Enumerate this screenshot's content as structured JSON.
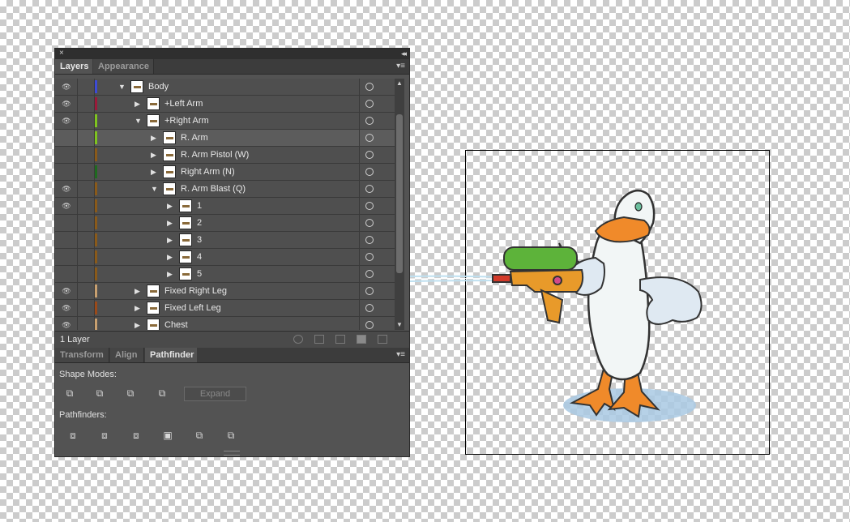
{
  "panel": {
    "close_glyph": "×",
    "collapse_glyph": "◂◂",
    "tabs": [
      {
        "label": "Layers",
        "active": true
      },
      {
        "label": "Appearance",
        "active": false
      }
    ],
    "menu_glyph": "▾≡"
  },
  "layers": {
    "rows": [
      {
        "name": "Body",
        "visible": true,
        "color": "#3d4bd6",
        "expanded": true,
        "depth": 0
      },
      {
        "name": "+Left Arm",
        "visible": true,
        "color": "#9b1a3a",
        "expanded": false,
        "depth": 1
      },
      {
        "name": "+Right Arm",
        "visible": true,
        "color": "#7fc41f",
        "expanded": true,
        "depth": 1
      },
      {
        "name": "R. Arm",
        "visible": false,
        "color": "#7fc41f",
        "expanded": false,
        "depth": 2,
        "selected": true
      },
      {
        "name": "R. Arm Pistol (W)",
        "visible": false,
        "color": "#8a5a1a",
        "expanded": false,
        "depth": 2
      },
      {
        "name": "Right Arm (N)",
        "visible": false,
        "color": "#1f6b1f",
        "expanded": false,
        "depth": 2
      },
      {
        "name": "R. Arm Blast (Q)",
        "visible": true,
        "color": "#8a5a1a",
        "expanded": true,
        "depth": 2
      },
      {
        "name": "1",
        "visible": true,
        "color": "#8a5a1a",
        "expanded": false,
        "depth": 3
      },
      {
        "name": "2",
        "visible": false,
        "color": "#8a5a1a",
        "expanded": false,
        "depth": 3
      },
      {
        "name": "3",
        "visible": false,
        "color": "#8a5a1a",
        "expanded": false,
        "depth": 3
      },
      {
        "name": "4",
        "visible": false,
        "color": "#8a5a1a",
        "expanded": false,
        "depth": 3
      },
      {
        "name": "5",
        "visible": false,
        "color": "#8a5a1a",
        "expanded": false,
        "depth": 3
      },
      {
        "name": "Fixed Right Leg",
        "visible": true,
        "color": "#c8a070",
        "expanded": false,
        "depth": 1
      },
      {
        "name": "Fixed Left Leg",
        "visible": true,
        "color": "#9b4a1a",
        "expanded": false,
        "depth": 1
      },
      {
        "name": "Chest",
        "visible": true,
        "color": "#c8a070",
        "expanded": false,
        "depth": 1
      }
    ]
  },
  "status": {
    "layer_count": "1 Layer",
    "icons": [
      "locate-object-icon",
      "make-clipping-mask-icon",
      "new-sublayer-icon",
      "new-layer-icon",
      "trash-icon"
    ]
  },
  "lower_tabs": [
    {
      "label": "Transform",
      "active": false
    },
    {
      "label": "Align",
      "active": false
    },
    {
      "label": "Pathfinder",
      "active": true
    }
  ],
  "pathfinder": {
    "shape_modes_label": "Shape Modes:",
    "shape_modes": [
      "unite-icon",
      "minus-front-icon",
      "intersect-icon",
      "exclude-icon"
    ],
    "expand_label": "Expand",
    "pathfinders_label": "Pathfinders:",
    "pathfinders": [
      "divide-icon",
      "trim-icon",
      "merge-icon",
      "crop-icon",
      "outline-icon",
      "minus-back-icon"
    ]
  },
  "colors": {
    "panel_bg": "#535353",
    "canvas_check": "#cccccc",
    "duck_body": "#f2f6f6",
    "duck_beak": "#f08a2a",
    "gun_tank": "#5db33a",
    "gun_body": "#e89a2a",
    "puddle": "#9fc4e0"
  }
}
